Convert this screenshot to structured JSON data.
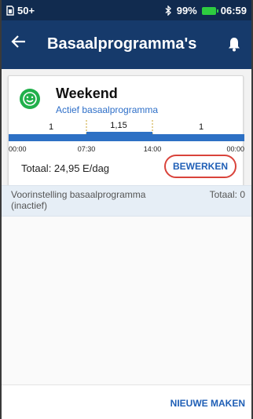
{
  "status_bar": {
    "sim_icon": "sim-card-icon",
    "signal": "50+",
    "bluetooth_icon": "bluetooth-icon",
    "battery": "99%",
    "battery_icon": "battery-icon",
    "time": "06:59"
  },
  "header": {
    "back_icon": "back-arrow-icon",
    "title": "Basaalprogramma's",
    "bell_icon": "bell-icon"
  },
  "active_program": {
    "icon": "smiley-icon",
    "name": "Weekend",
    "status": "Actief basaalprogramma",
    "total": "Totaal: 24,95 E/dag",
    "edit_label": "BEWERKEN",
    "segments": [
      {
        "label": "1"
      },
      {
        "label": "1,15"
      },
      {
        "label": "1"
      }
    ],
    "times": [
      "00:00",
      "07:30",
      "14:00",
      "00:00"
    ]
  },
  "preset_program": {
    "name": "Voorinstelling basaalprogramma (inactief)",
    "total": "Totaal: 0"
  },
  "footer": {
    "new_label": "NIEUWE MAKEN"
  },
  "colors": {
    "header": "#163a6b",
    "status_bar": "#112b4f",
    "accent": "#1f5fb6",
    "edit_outline": "#d9433b",
    "smiley": "#21b04b"
  }
}
